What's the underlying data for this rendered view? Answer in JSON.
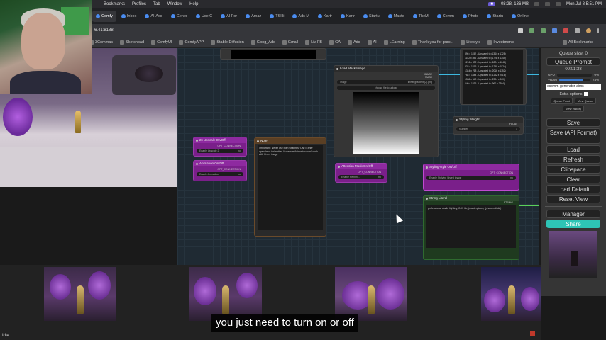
{
  "menubar": {
    "items": [
      "Bookmarks",
      "Profiles",
      "Tab",
      "Window",
      "Help"
    ],
    "status": "08:28, 136 MB",
    "clock": "Mon Jul 8  5:51 PM"
  },
  "tabs": [
    "Comfy",
    "Inbox",
    "AI-Ass",
    "Gener",
    "Use C",
    "AI For",
    "Amaz",
    "TSHi",
    "Ads M",
    "Kartr",
    "Kartr",
    "Startu",
    "Maste",
    "TheM",
    "Comm",
    "Photo",
    "Startu",
    "Online"
  ],
  "address": {
    "url": "6.41:8188"
  },
  "bookmarks": {
    "items": [
      "3Commas",
      "Sketchpad",
      "ComfyUI",
      "ComfyAPP",
      "Stable Diffusion",
      "Goog_Ads",
      "Gmail",
      "Liv-FB",
      "GA",
      "Ads",
      "AI",
      "LEarning",
      "Thank you for purc...",
      "Lifestyle",
      "Investments"
    ],
    "all": "All Bookmarks"
  },
  "nodes": {
    "upscale_onoff": {
      "title": "2x Upscale On/Off",
      "out": "OPT_CONNECTION",
      "widget_label": "Enable Upscale 2",
      "widget_value": "no"
    },
    "animation_onoff": {
      "title": "Animation On/Off",
      "out": "OPT_CONNECTION",
      "widget_label": "Enable Animation",
      "widget_value": "no"
    },
    "note": {
      "title": "Note",
      "text": "[Important: Never use both switches \"ON\"] Either upscale or Animation. Moreover Animation won't work with hi-res image"
    },
    "load_mask": {
      "title": "Load Mask Image",
      "out1": "IMAGE",
      "out2": "MASK",
      "image_label": "image",
      "image_value": "linear gradient (2).png",
      "upload": "choose file to upload"
    },
    "attention_mask": {
      "title": "Attention Mask On/Off",
      "out": "OPT_CONNECTION",
      "widget_label": "Enable Refinin...",
      "widget_value": "no"
    },
    "upscale_list": [
      "896 x 1152 - Upscaled to (1344 x 1728)",
      "1152 x 896 - Upscaled to (1728 x 1344)",
      "1216 x 832 - Upscaled to (1824 x 1248)",
      "832 x 1216 - Upscaled to (1248 x 1824)",
      "1344 x 768 - Upscaled to (2016 x 1152)",
      "768 x 1344 - Upscaled to (1152 x 2016)",
      "1536 x 640 - Upscaled to (2304 x 960)",
      "640 x 1536 - Upscaled to (960 x 2304)"
    ],
    "styling_weight": {
      "title": "Styling Weight",
      "out": "FLOAT",
      "widget_label": "Number",
      "widget_value": "1"
    },
    "styling_style": {
      "title": "Styling-style On/Off",
      "out": "OPT_CONNECTION",
      "widget_label": "Enable Stylying Styled image",
      "widget_value": "no"
    },
    "string_literal": {
      "title": "String Literal",
      "out": "STRING",
      "text": "professional studio lighting, 24K, 8k, (masterpiece), (photorealistic)"
    }
  },
  "panel": {
    "queue_size": "Queue size: 0",
    "queue_prompt": "Queue Prompt",
    "timer": "00:01:38",
    "gpu_label": "GPU",
    "gpu_value": "0%",
    "gpu_pct": 0,
    "vram_label": "VRAM",
    "vram_value": "74%",
    "vram_pct": 74,
    "prefix": "ecomm-generator-aims",
    "extra_options": "Extra options",
    "queue_front": "Queue Front",
    "view_queue": "View Queue",
    "view_history": "View History",
    "save": "Save",
    "save_api": "Save (API Format)",
    "load": "Load",
    "refresh": "Refresh",
    "clipspace": "Clipspace",
    "clear": "Clear",
    "load_default": "Load Default",
    "reset_view": "Reset View",
    "manager": "Manager",
    "share": "Share"
  },
  "status": {
    "idle": "Idle"
  },
  "caption": "you just need to turn on or off",
  "colors": {
    "accent_share": "#2ec4b6",
    "node_purple": "#7a1f8a",
    "wire_blue": "#3db8e0",
    "wire_green": "#5ad05a"
  }
}
